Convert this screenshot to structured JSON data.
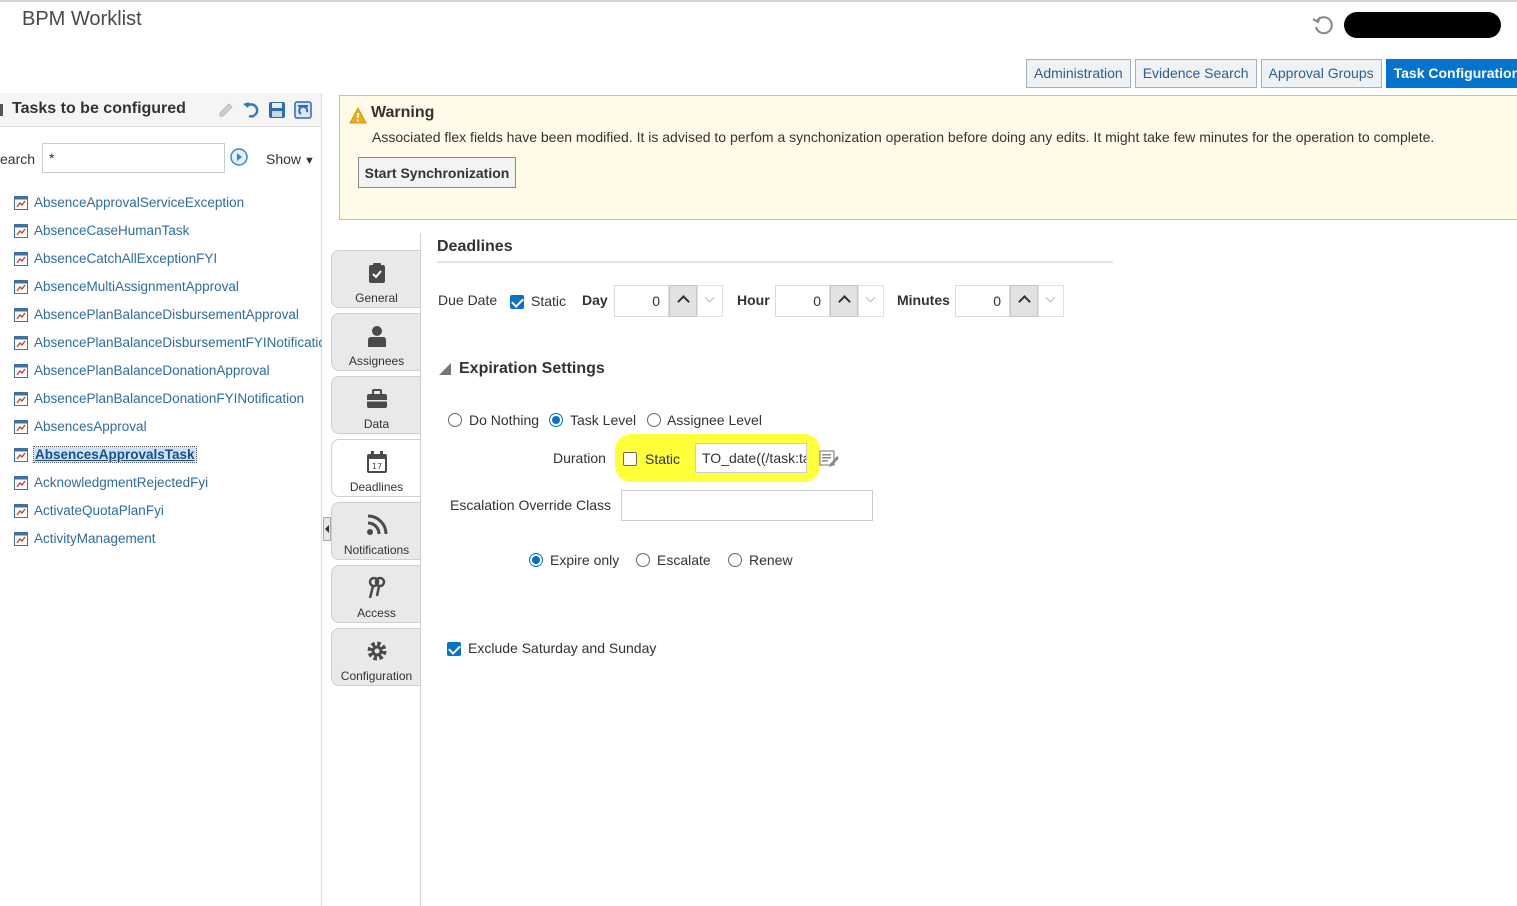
{
  "app": {
    "title": "BPM Worklist"
  },
  "header": {
    "refresh_icon": "refresh-icon",
    "user_menu": "redacted"
  },
  "top_tabs": [
    {
      "label": "Administration",
      "active": false
    },
    {
      "label": "Evidence Search",
      "active": false
    },
    {
      "label": "Approval Groups",
      "active": false
    },
    {
      "label": "Task Configuration",
      "active": true
    }
  ],
  "left_panel": {
    "title": "Tasks to be configured",
    "toolbar_icons": [
      "edit-icon",
      "undo-icon",
      "save-icon",
      "commit-icon"
    ],
    "search": {
      "label": "earch",
      "value": "*",
      "show_label": "Show"
    },
    "tasks": [
      {
        "label": "AbsenceApprovalServiceException"
      },
      {
        "label": "AbsenceCaseHumanTask"
      },
      {
        "label": "AbsenceCatchAllExceptionFYI"
      },
      {
        "label": "AbsenceMultiAssignmentApproval"
      },
      {
        "label": "AbsencePlanBalanceDisbursementApproval"
      },
      {
        "label": "AbsencePlanBalanceDisbursementFYINotificatio"
      },
      {
        "label": "AbsencePlanBalanceDonationApproval"
      },
      {
        "label": "AbsencePlanBalanceDonationFYINotification"
      },
      {
        "label": "AbsencesApproval"
      },
      {
        "label": "AbsencesApprovalsTask",
        "selected": true
      },
      {
        "label": "AcknowledgmentRejectedFyi"
      },
      {
        "label": "ActivateQuotaPlanFyi"
      },
      {
        "label": "ActivityManagement"
      }
    ]
  },
  "warning": {
    "title": "Warning",
    "message": "Associated flex fields have been modified. It is advised to perfom a synchonization operation before doing any edits. It might take few minutes for the operation to complete.",
    "button": "Start Synchronization"
  },
  "side_tabs": [
    {
      "label": "General",
      "icon": "clipboard-check-icon"
    },
    {
      "label": "Assignees",
      "icon": "person-icon"
    },
    {
      "label": "Data",
      "icon": "briefcase-icon"
    },
    {
      "label": "Deadlines",
      "icon": "calendar-icon",
      "active": true
    },
    {
      "label": "Notifications",
      "icon": "rss-icon"
    },
    {
      "label": "Access",
      "icon": "keys-icon"
    },
    {
      "label": "Configuration",
      "icon": "gear-icon"
    }
  ],
  "deadlines": {
    "title": "Deadlines",
    "due_date_label": "Due Date",
    "static_label": "Static",
    "static_checked": true,
    "day_label": "Day",
    "day_value": "0",
    "hour_label": "Hour",
    "hour_value": "0",
    "minutes_label": "Minutes",
    "minutes_value": "0"
  },
  "expiration": {
    "title": "Expiration Settings",
    "level_options": [
      {
        "label": "Do Nothing",
        "selected": false
      },
      {
        "label": "Task Level",
        "selected": true
      },
      {
        "label": "Assignee Level",
        "selected": false
      }
    ],
    "duration_label": "Duration",
    "duration_static_label": "Static",
    "duration_static_checked": false,
    "duration_value": "TO_date((/task:ta",
    "escalation_override_label": "Escalation Override Class",
    "escalation_override_value": "",
    "action_options": [
      {
        "label": "Expire only",
        "selected": true
      },
      {
        "label": "Escalate",
        "selected": false
      },
      {
        "label": "Renew",
        "selected": false
      }
    ],
    "exclude_weekend_label": "Exclude Saturday and Sunday",
    "exclude_weekend_checked": true
  },
  "colors": {
    "accent": "#0572ce",
    "highlight": "#ffff3a",
    "warning_bg": "#fffbe8"
  }
}
